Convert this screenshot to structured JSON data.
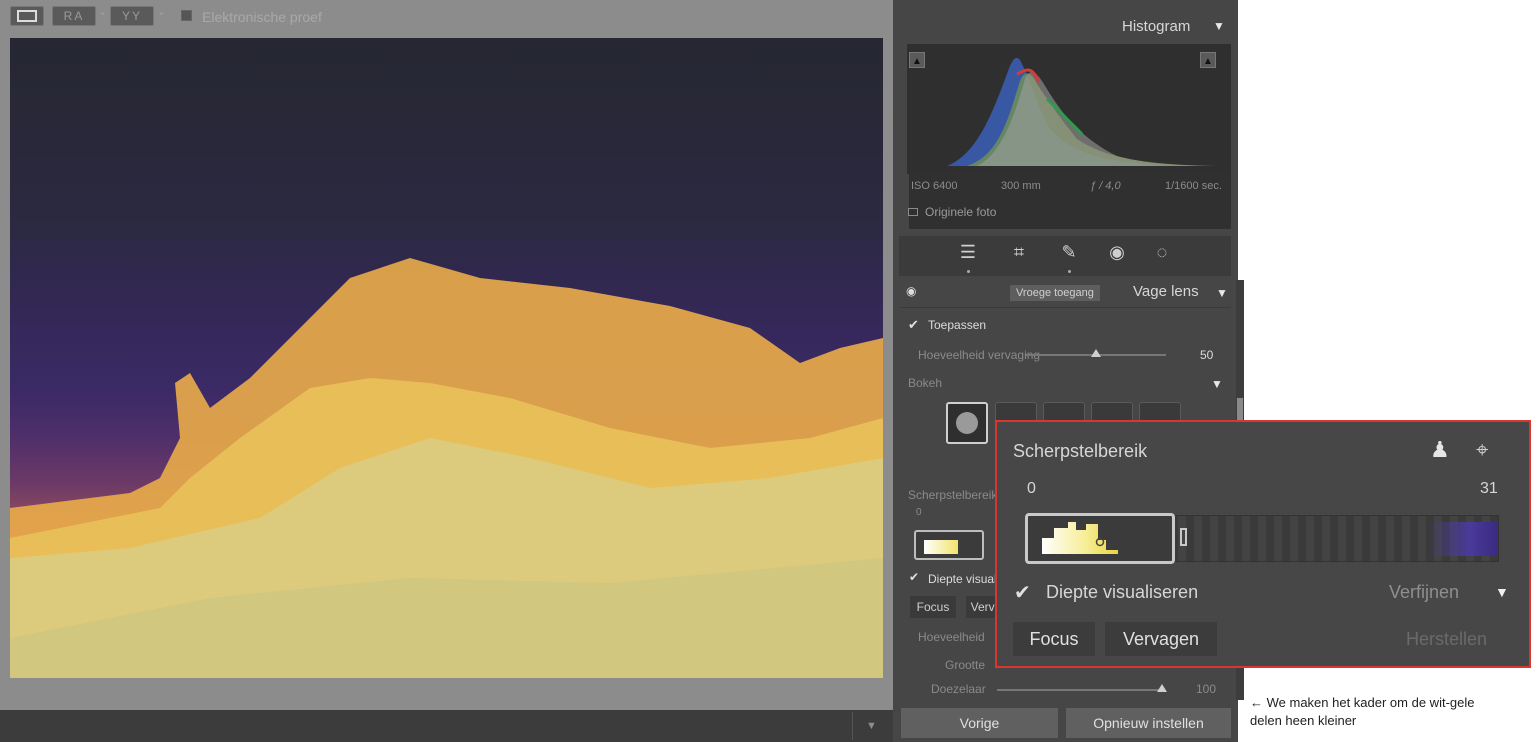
{
  "histogram": {
    "title": "Histogram",
    "exif": {
      "iso": "ISO 6400",
      "focal": "300 mm",
      "aperture": "ƒ / 4,0",
      "shutter": "1/1600 sec."
    },
    "original_label": "Originele foto"
  },
  "blur_panel": {
    "badge": "Vroege toegang",
    "title": "Vage lens",
    "apply_label": "Toepassen",
    "amount_label": "Hoeveelheid vervaging",
    "amount_value": "50",
    "amount_fraction": 0.5,
    "bokeh_label": "Bokeh",
    "focus_range_label": "Scherpstelbereik",
    "range_min": "0",
    "visualize_label": "Diepte visualiseren",
    "focus_btn": "Focus",
    "fade_btn": "Vervagen",
    "amount2_label": "Hoeveelheid",
    "size_label": "Grootte",
    "dither_label": "Doezelaar",
    "dither_value": "100",
    "dither_fraction": 1.0
  },
  "zoom": {
    "title": "Scherpstelbereik",
    "min": "0",
    "max": "31",
    "visualize": "Diepte visualiseren",
    "refine": "Verfijnen",
    "focus": "Focus",
    "fade": "Vervagen",
    "reset": "Herstellen"
  },
  "footer": {
    "prev": "Vorige",
    "reset": "Opnieuw instellen",
    "proof": "Elektronische proef",
    "ra": "RA",
    "yy": "YY"
  },
  "caption": "← We maken het kader om de wit-gele delen heen kleiner",
  "colors": {
    "accent_red": "#d8362f",
    "panel": "#464646",
    "viewer": "#8c8c8c"
  }
}
